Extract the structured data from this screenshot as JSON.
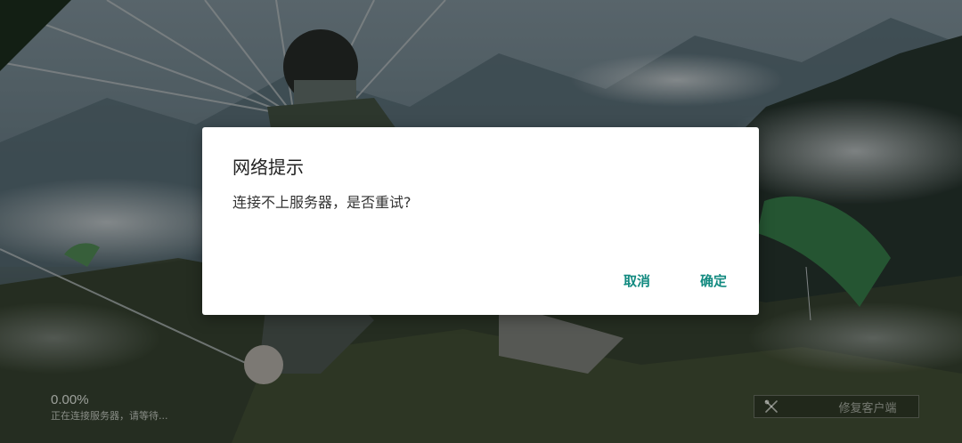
{
  "background": {
    "scene": "parachute-skydiver-mountain-artwork"
  },
  "loading": {
    "percent": "0.00%",
    "status": "正在连接服务器，请等待..."
  },
  "repair": {
    "label": "修复客户端",
    "icon": "wrench-screwdriver-icon"
  },
  "dialog": {
    "title": "网络提示",
    "message": "连接不上服务器，是否重试?",
    "cancel_label": "取消",
    "confirm_label": "确定",
    "accent_color": "#128a80"
  }
}
